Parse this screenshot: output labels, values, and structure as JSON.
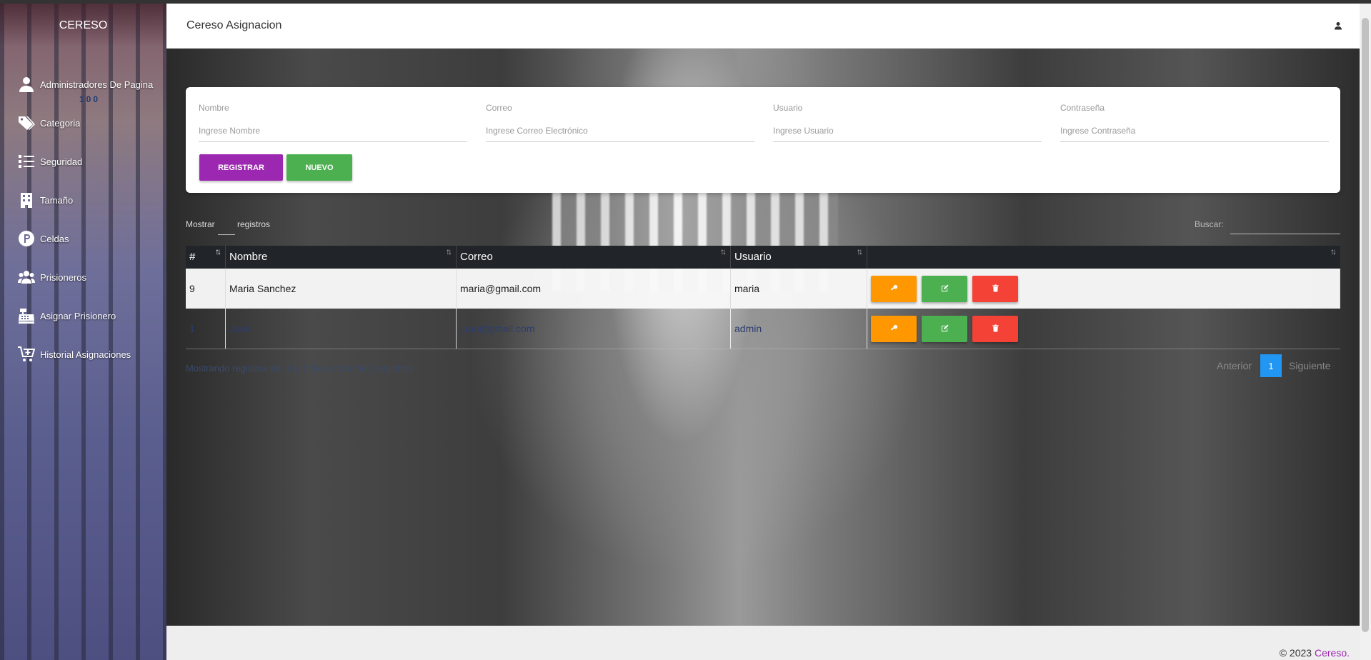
{
  "sidebar": {
    "brand": "CERESO",
    "brand_mark": "100",
    "items": [
      {
        "label": "Administradores De Pagina",
        "icon": "user-icon"
      },
      {
        "label": "Categoria",
        "icon": "tags-icon"
      },
      {
        "label": "Seguridad",
        "icon": "list-icon"
      },
      {
        "label": "Tamaño",
        "icon": "building-icon"
      },
      {
        "label": "Celdas",
        "icon": "parking-icon"
      },
      {
        "label": "Prisioneros",
        "icon": "users-icon"
      },
      {
        "label": "Asignar Prisionero",
        "icon": "cash-register-icon"
      },
      {
        "label": "Historial Asignaciones",
        "icon": "cart-plus-icon"
      }
    ]
  },
  "header": {
    "title": "Cereso Asignacion",
    "user_icon": "user-icon"
  },
  "form": {
    "fields": [
      {
        "label": "Nombre",
        "placeholder": "Ingrese Nombre"
      },
      {
        "label": "Correo",
        "placeholder": "Ingrese Correo Electrónico"
      },
      {
        "label": "Usuario",
        "placeholder": "Ingrese Usuario"
      },
      {
        "label": "Contraseña",
        "placeholder": "Ingrese Contraseña"
      }
    ],
    "register_label": "REGISTRAR",
    "new_label": "NUEVO",
    "colors": {
      "register": "#9c27b0",
      "new": "#4caf50"
    }
  },
  "table_controls": {
    "show_prefix": "Mostrar",
    "show_suffix": "registros",
    "search_label": "Buscar:"
  },
  "table": {
    "headers": [
      "#",
      "Nombre",
      "Correo",
      "Usuario",
      ""
    ],
    "rows": [
      {
        "id": "9",
        "nombre": "Maria Sanchez",
        "correo": "maria@gmail.com",
        "usuario": "maria"
      },
      {
        "id": "1",
        "nombre": "Juan",
        "correo": "juan@gmail.com",
        "usuario": "admin"
      }
    ],
    "action_icons": [
      "key-icon",
      "edit-icon",
      "trash-icon"
    ],
    "action_colors": {
      "key": "#ff9800",
      "edit": "#4caf50",
      "delete": "#f44336"
    },
    "info": "Mostrando registros del 1 al 2 de un total de 2 registros"
  },
  "pagination": {
    "previous": "Anterior",
    "current": "1",
    "next": "Siguiente"
  },
  "footer": {
    "copyright": "© 2023",
    "brand": "Cereso."
  }
}
